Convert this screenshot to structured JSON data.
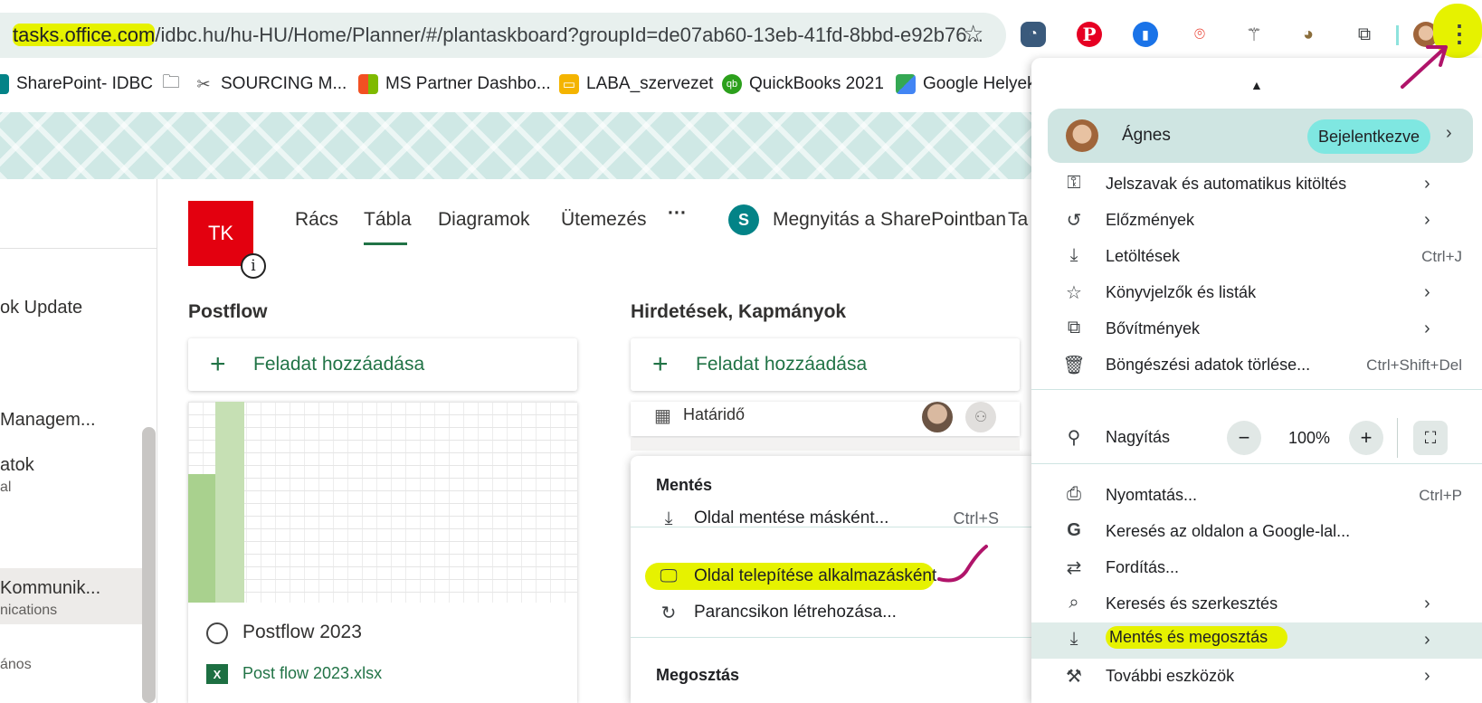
{
  "browser": {
    "url_host": "tasks.office.com",
    "url_rest": "/idbc.hu/hu-HU/Home/Planner/#/plantaskboard?groupId=de07ab60-13eb-41fd-8bbd-e92b76..."
  },
  "bookmarks": [
    {
      "label": "SharePoint- IDBC",
      "icon": "sharepoint-icon"
    },
    {
      "label": "",
      "icon": "folder-icon"
    },
    {
      "label": "SOURCING M...",
      "icon": "tools-icon"
    },
    {
      "label": "MS Partner Dashbo...",
      "icon": "microsoft-icon"
    },
    {
      "label": "LABA_szervezet",
      "icon": "slides-icon"
    },
    {
      "label": "QuickBooks 2021",
      "icon": "quickbooks-icon"
    },
    {
      "label": "Google Helyek",
      "icon": "maps-icon"
    }
  ],
  "leftnav": {
    "items": [
      "ok Update",
      "Managem...",
      "atok",
      "al",
      "Kommunik...",
      "nications",
      "ános"
    ]
  },
  "planner": {
    "badge": "TK",
    "info_glyph": "i",
    "tabs": [
      "Rács",
      "Tábla",
      "Diagramok",
      "Ütemezés",
      "···"
    ],
    "active_tab": "Tábla",
    "sharepoint_label": "Megnyitás a SharePointban",
    "sharepoint_glyph": "S",
    "tab_cut": "Ta",
    "buckets": [
      {
        "title": "Postflow",
        "add_label": "Feladat hozzáadása"
      },
      {
        "title": "Hirdetések, Kapmányok",
        "add_label": "Feladat hozzáadása"
      }
    ],
    "card": {
      "title": "Postflow 2023",
      "file": "Post flow 2023.xlsx",
      "file_icon": "X"
    },
    "card2": {
      "due_label": "Határidő"
    }
  },
  "submenu": {
    "save_header": "Mentés",
    "items": [
      {
        "label": "Oldal mentése másként...",
        "shortcut": "Ctrl+S",
        "icon": "save-page-icon"
      },
      {
        "label": "Oldal telepítése alkalmazásként...",
        "shortcut": "",
        "icon": "install-app-icon"
      },
      {
        "label": "Parancsikon létrehozása...",
        "shortcut": "",
        "icon": "shortcut-icon"
      }
    ],
    "share_header": "Megosztás"
  },
  "menu": {
    "profile_name": "Ágnes",
    "profile_status": "Bejelentkezve",
    "items": [
      {
        "label": "Jelszavak és automatikus kitöltés",
        "shortcut": "",
        "chevron": true,
        "icon": "key-icon"
      },
      {
        "label": "Előzmények",
        "shortcut": "",
        "chevron": true,
        "icon": "history-icon"
      },
      {
        "label": "Letöltések",
        "shortcut": "Ctrl+J",
        "chevron": false,
        "icon": "download-icon"
      },
      {
        "label": "Könyvjelzők és listák",
        "shortcut": "",
        "chevron": true,
        "icon": "star-icon"
      },
      {
        "label": "Bővítmények",
        "shortcut": "",
        "chevron": true,
        "icon": "puzzle-icon"
      },
      {
        "label": "Böngészési adatok törlése...",
        "shortcut": "Ctrl+Shift+Del",
        "chevron": false,
        "icon": "trash-icon"
      }
    ],
    "zoom_label": "Nagyítás",
    "zoom_value": "100%",
    "zoom_minus": "−",
    "zoom_plus": "+",
    "items2": [
      {
        "label": "Nyomtatás...",
        "shortcut": "Ctrl+P",
        "chevron": false,
        "icon": "print-icon"
      },
      {
        "label": "Keresés az oldalon a Google-lal...",
        "shortcut": "",
        "chevron": false,
        "icon": "google-icon"
      },
      {
        "label": "Fordítás...",
        "shortcut": "",
        "chevron": false,
        "icon": "translate-icon"
      },
      {
        "label": "Keresés és szerkesztés",
        "shortcut": "",
        "chevron": true,
        "icon": "find-icon"
      },
      {
        "label": "Mentés és megosztás",
        "shortcut": "",
        "chevron": true,
        "icon": "save-share-icon"
      },
      {
        "label": "További eszközök",
        "shortcut": "",
        "chevron": true,
        "icon": "toolbox-icon"
      }
    ]
  },
  "colors": {
    "highlight": "#e6f200",
    "annotation": "#b0146a",
    "planner_green": "#217346",
    "badge_red": "#e3000f"
  }
}
